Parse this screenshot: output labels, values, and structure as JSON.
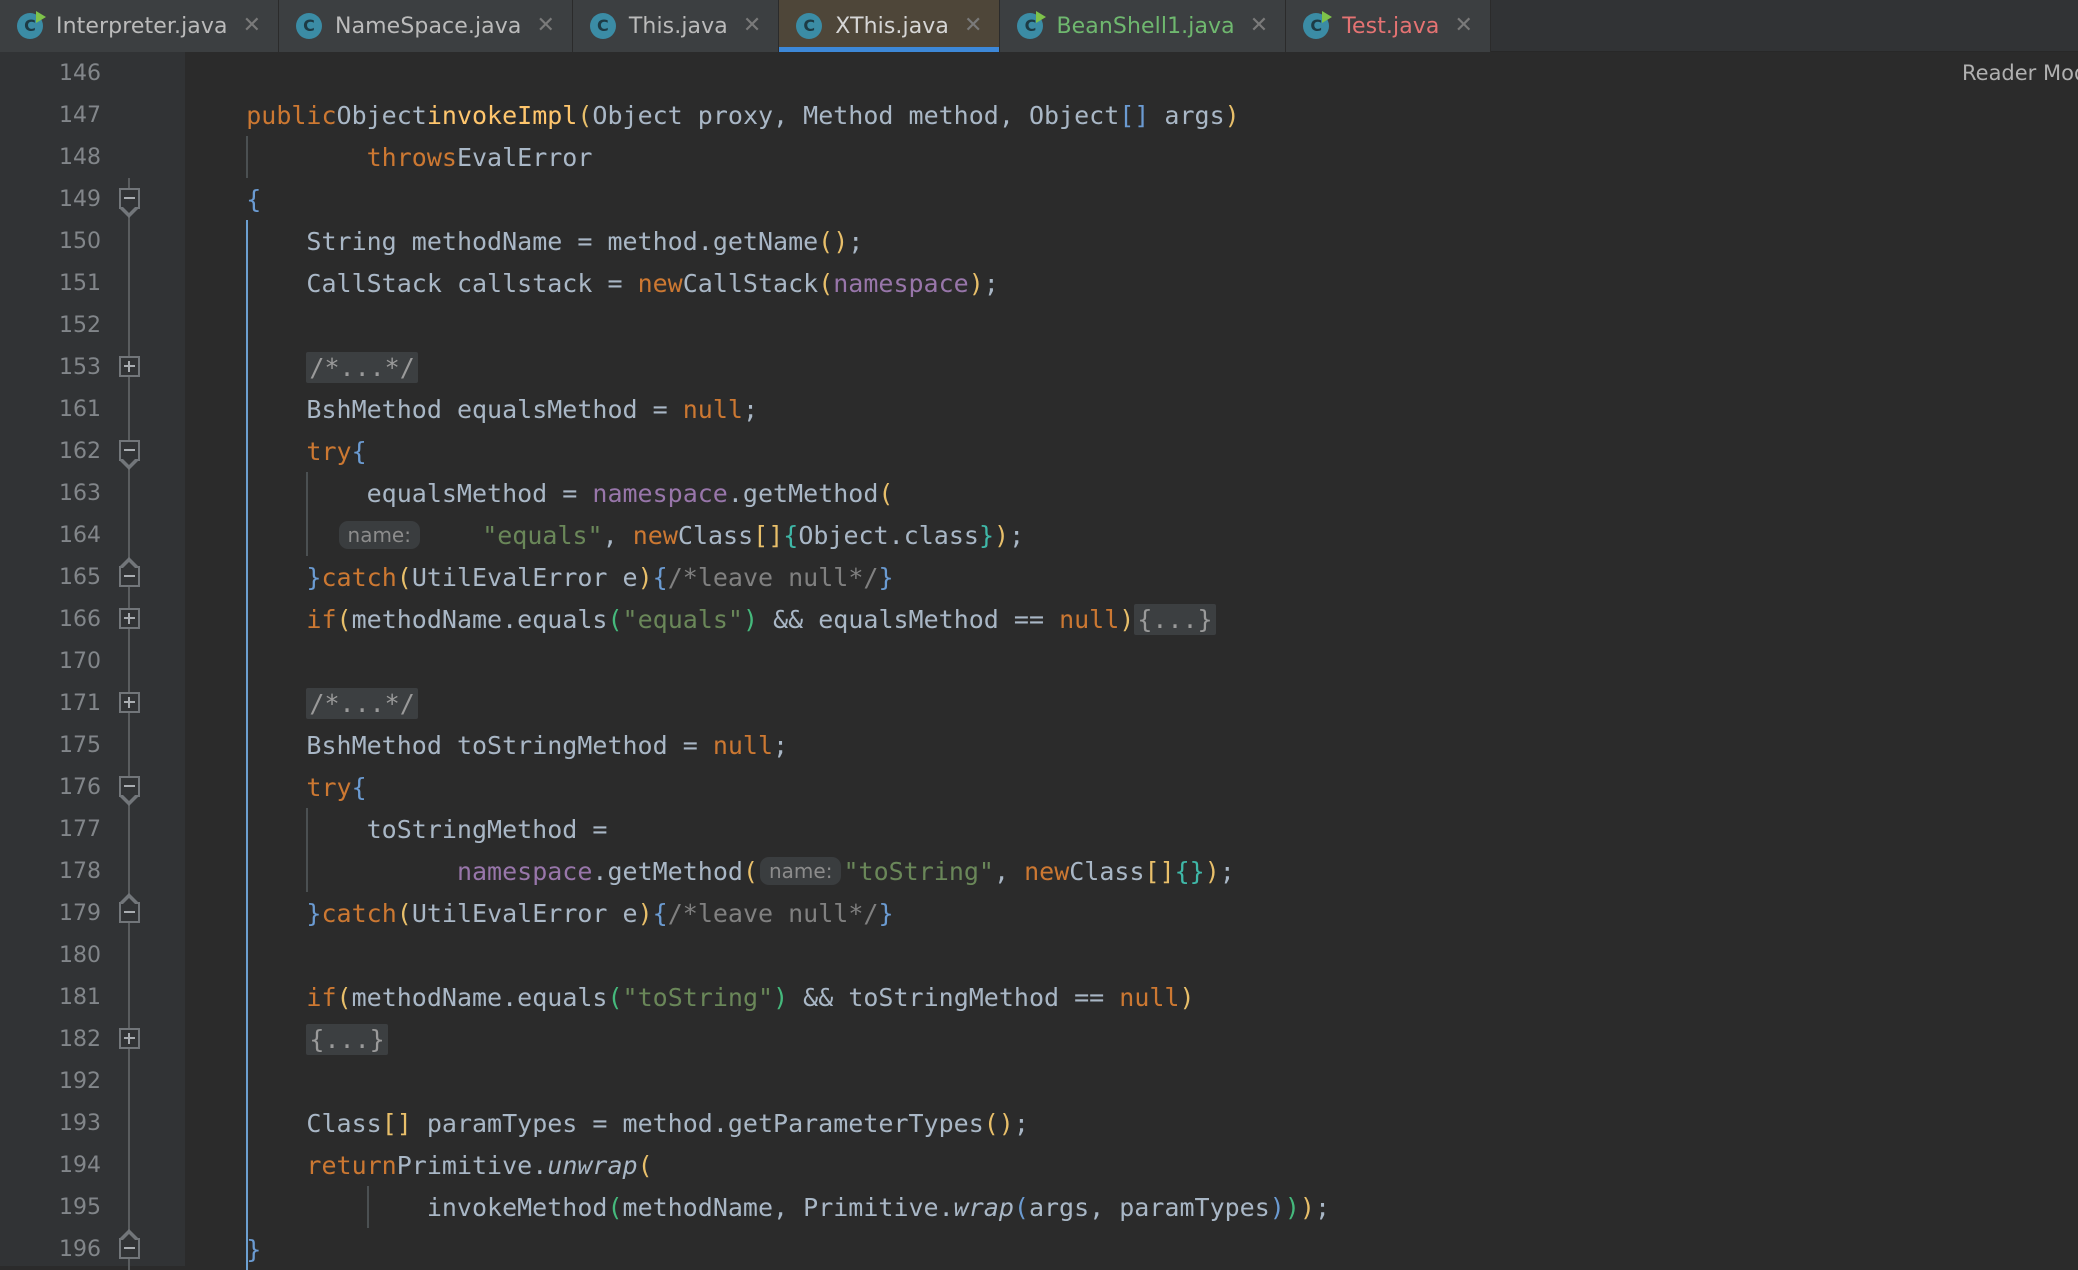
{
  "window": {
    "app": "IntelliJ IDEA",
    "reader_mode_label": "Reader Mod"
  },
  "colors": {
    "editor_bg": "#2b2b2b",
    "gutter_bg": "#313335",
    "tab_bg": "#3c3f41",
    "tab_active_bg": "#4e4639",
    "tab_active_underline": "#3d88d8",
    "keyword": "#cc7832",
    "method": "#ffc66d",
    "field": "#9876aa",
    "string": "#6a8759",
    "comment": "#808080",
    "text": "#a9b7c6",
    "line_number": "#82868a",
    "vcs_added": "#6fb86f",
    "vcs_unknown": "#e57373",
    "icon_disc": "#3b8ca5",
    "icon_run_arrow": "#7ec24a"
  },
  "tabs": [
    {
      "label": "Interpreter.java",
      "icon": "java-class-icon",
      "run_arrow": true,
      "active": false,
      "vcs": "none",
      "close": "✕"
    },
    {
      "label": "NameSpace.java",
      "icon": "java-class-icon",
      "run_arrow": false,
      "active": false,
      "vcs": "none",
      "close": "✕"
    },
    {
      "label": "This.java",
      "icon": "java-class-icon",
      "run_arrow": false,
      "active": false,
      "vcs": "none",
      "close": "✕"
    },
    {
      "label": "XThis.java",
      "icon": "java-class-icon",
      "run_arrow": false,
      "active": true,
      "vcs": "none",
      "close": "✕"
    },
    {
      "label": "BeanShell1.java",
      "icon": "java-class-icon",
      "run_arrow": true,
      "active": false,
      "vcs": "added",
      "close": "✕"
    },
    {
      "label": "Test.java",
      "icon": "java-class-icon",
      "run_arrow": true,
      "active": false,
      "vcs": "unknown",
      "close": "✕"
    }
  ],
  "editor": {
    "language": "Java",
    "line_numbers": [
      146,
      147,
      148,
      149,
      150,
      151,
      152,
      153,
      161,
      162,
      163,
      164,
      165,
      166,
      170,
      171,
      175,
      176,
      177,
      178,
      179,
      180,
      181,
      182,
      192,
      193,
      194,
      195,
      196
    ],
    "fold_markers": {
      "149": "minus-down",
      "153": "plus",
      "162": "minus-down",
      "165": "minus-up",
      "166": "plus",
      "171": "plus",
      "176": "minus-down",
      "179": "minus-up",
      "182": "plus",
      "196": "minus-up"
    },
    "folded_placeholders": [
      "/*...*/",
      "{...}"
    ],
    "inlay_hints": [
      "name:",
      "name:"
    ],
    "lines": [
      {
        "num": 146,
        "text": ""
      },
      {
        "num": 147,
        "text": "    public Object invokeImpl(Object proxy, Method method, Object[] args)"
      },
      {
        "num": 148,
        "text": "            throws EvalError"
      },
      {
        "num": 149,
        "text": "    {"
      },
      {
        "num": 150,
        "text": "        String methodName = method.getName();"
      },
      {
        "num": 151,
        "text": "        CallStack callstack = new CallStack(namespace);"
      },
      {
        "num": 152,
        "text": ""
      },
      {
        "num": 153,
        "text": "        /*...*/"
      },
      {
        "num": 161,
        "text": "        BshMethod equalsMethod = null;"
      },
      {
        "num": 162,
        "text": "        try {"
      },
      {
        "num": 163,
        "text": "            equalsMethod = namespace.getMethod("
      },
      {
        "num": 164,
        "text": "                name:    \"equals\", new Class[]{Object.class});"
      },
      {
        "num": 165,
        "text": "        } catch (UtilEvalError e) {/*leave null*/ }"
      },
      {
        "num": 166,
        "text": "        if (methodName.equals(\"equals\") && equalsMethod == null) {...}"
      },
      {
        "num": 170,
        "text": ""
      },
      {
        "num": 171,
        "text": "        /*...*/"
      },
      {
        "num": 175,
        "text": "        BshMethod toStringMethod = null;"
      },
      {
        "num": 176,
        "text": "        try {"
      },
      {
        "num": 177,
        "text": "            toStringMethod ="
      },
      {
        "num": 178,
        "text": "                    namespace.getMethod( name: \"toString\", new Class[]{});"
      },
      {
        "num": 179,
        "text": "        } catch (UtilEvalError e) {/*leave null*/ }"
      },
      {
        "num": 180,
        "text": ""
      },
      {
        "num": 181,
        "text": "        if (methodName.equals(\"toString\") && toStringMethod == null)"
      },
      {
        "num": 182,
        "text": "        {...}"
      },
      {
        "num": 192,
        "text": ""
      },
      {
        "num": 193,
        "text": "        Class[] paramTypes = method.getParameterTypes();"
      },
      {
        "num": 194,
        "text": "        return Primitive.unwrap("
      },
      {
        "num": 195,
        "text": "                invokeMethod(methodName, Primitive.wrap(args, paramTypes)));"
      },
      {
        "num": 196,
        "text": "    }"
      }
    ]
  }
}
